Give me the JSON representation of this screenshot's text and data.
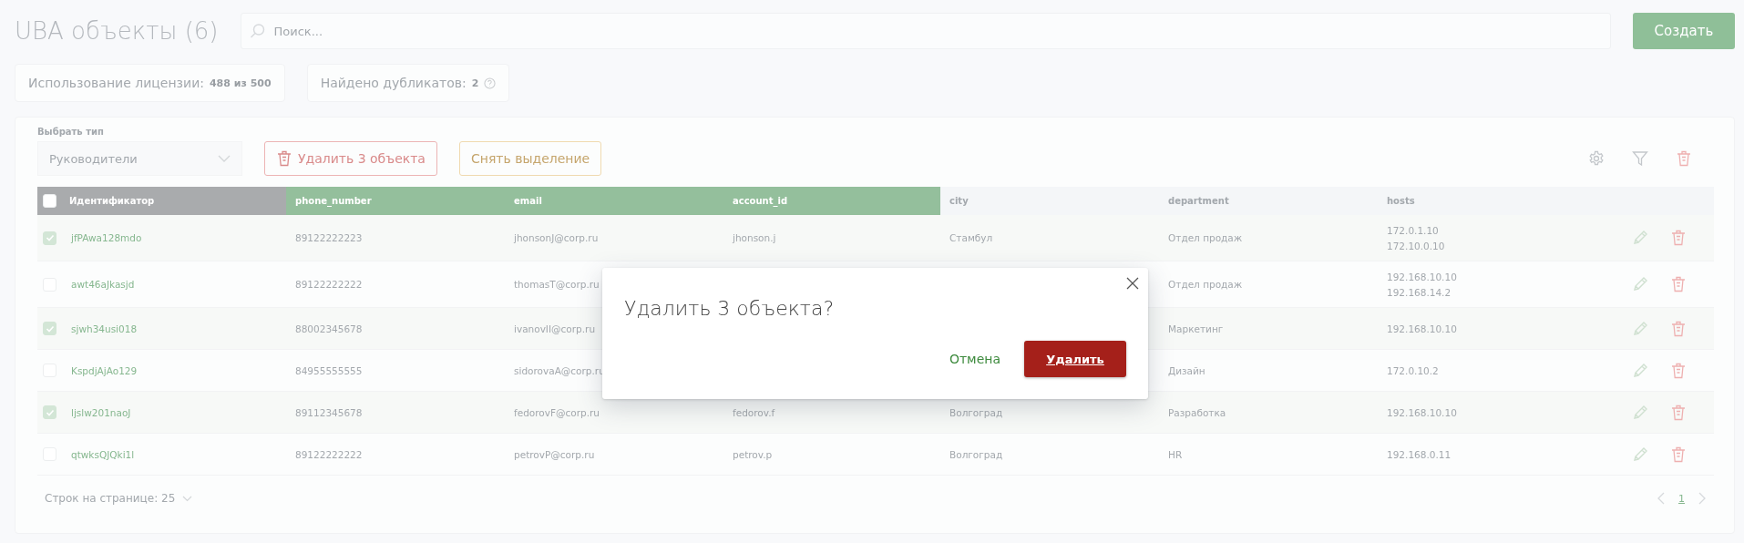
{
  "header": {
    "title": "UBA объекты (6)",
    "search": {
      "placeholder": "Поиск..."
    },
    "create_button": "Создать"
  },
  "stats": [
    {
      "label": "Использование лицензии:",
      "value": "488 из 500",
      "help": false
    },
    {
      "label": "Найдено дубликатов:",
      "value": "2",
      "help": true
    }
  ],
  "toolbar": {
    "type_label": "Выбрать тип",
    "type_value": "Руководители",
    "delete_button": "Удалить 3 объекта",
    "deselect_button": "Снять выделение"
  },
  "table": {
    "header_checked": false,
    "columns": [
      {
        "label": "Идентификатор",
        "kind": "pinned"
      },
      {
        "label": "phone_number",
        "kind": "highlighted"
      },
      {
        "label": "email",
        "kind": "highlighted"
      },
      {
        "label": "account_id",
        "kind": "highlighted"
      },
      {
        "label": "city",
        "kind": "plain"
      },
      {
        "label": "department",
        "kind": "plain"
      },
      {
        "label": "hosts",
        "kind": "plain"
      }
    ],
    "rows": [
      {
        "selected": true,
        "id": "jfPAwa128mdo",
        "phone": "89122222223",
        "email": "jhonsonJ@corp.ru",
        "account_id": "jhonson.j",
        "city": "Стамбул",
        "department": "Отдел продаж",
        "hosts": [
          "172.0.1.10",
          "172.10.0.10"
        ]
      },
      {
        "selected": false,
        "id": "awt46aJkasjd",
        "phone": "89122222222",
        "email": "thomasT@corp.ru",
        "department": "Отдел продаж",
        "hosts": [
          "192.168.10.10",
          "192.168.14.2"
        ]
      },
      {
        "selected": true,
        "id": "sjwh34usi018",
        "phone": "88002345678",
        "email": "ivanovII@corp.ru",
        "department": "Маркетинг",
        "hosts": [
          "192.168.10.10"
        ]
      },
      {
        "selected": false,
        "id": "KspdjAjAo129",
        "phone": "84955555555",
        "email": "sidorovaA@corp.ru",
        "department": "Дизайн",
        "hosts": [
          "172.0.10.2"
        ]
      },
      {
        "selected": true,
        "id": "ljslw201naoJ",
        "phone": "89112345678",
        "email": "fedorovF@corp.ru",
        "account_id": "fedorov.f",
        "city": "Волгоград",
        "department": "Разработка",
        "hosts": [
          "192.168.10.10"
        ]
      },
      {
        "selected": false,
        "id": "qtwksQJQki1l",
        "phone": "89122222222",
        "email": "petrovP@corp.ru",
        "account_id": "petrov.p",
        "city": "Волгоград",
        "department": "HR",
        "hosts": [
          "192.168.0.11"
        ]
      }
    ]
  },
  "footer": {
    "rows_per_page": "Строк на странице: 25",
    "page": "1"
  },
  "dialog": {
    "title": "Удалить 3 объекта?",
    "cancel": "Отмена",
    "confirm": "Удалить"
  }
}
